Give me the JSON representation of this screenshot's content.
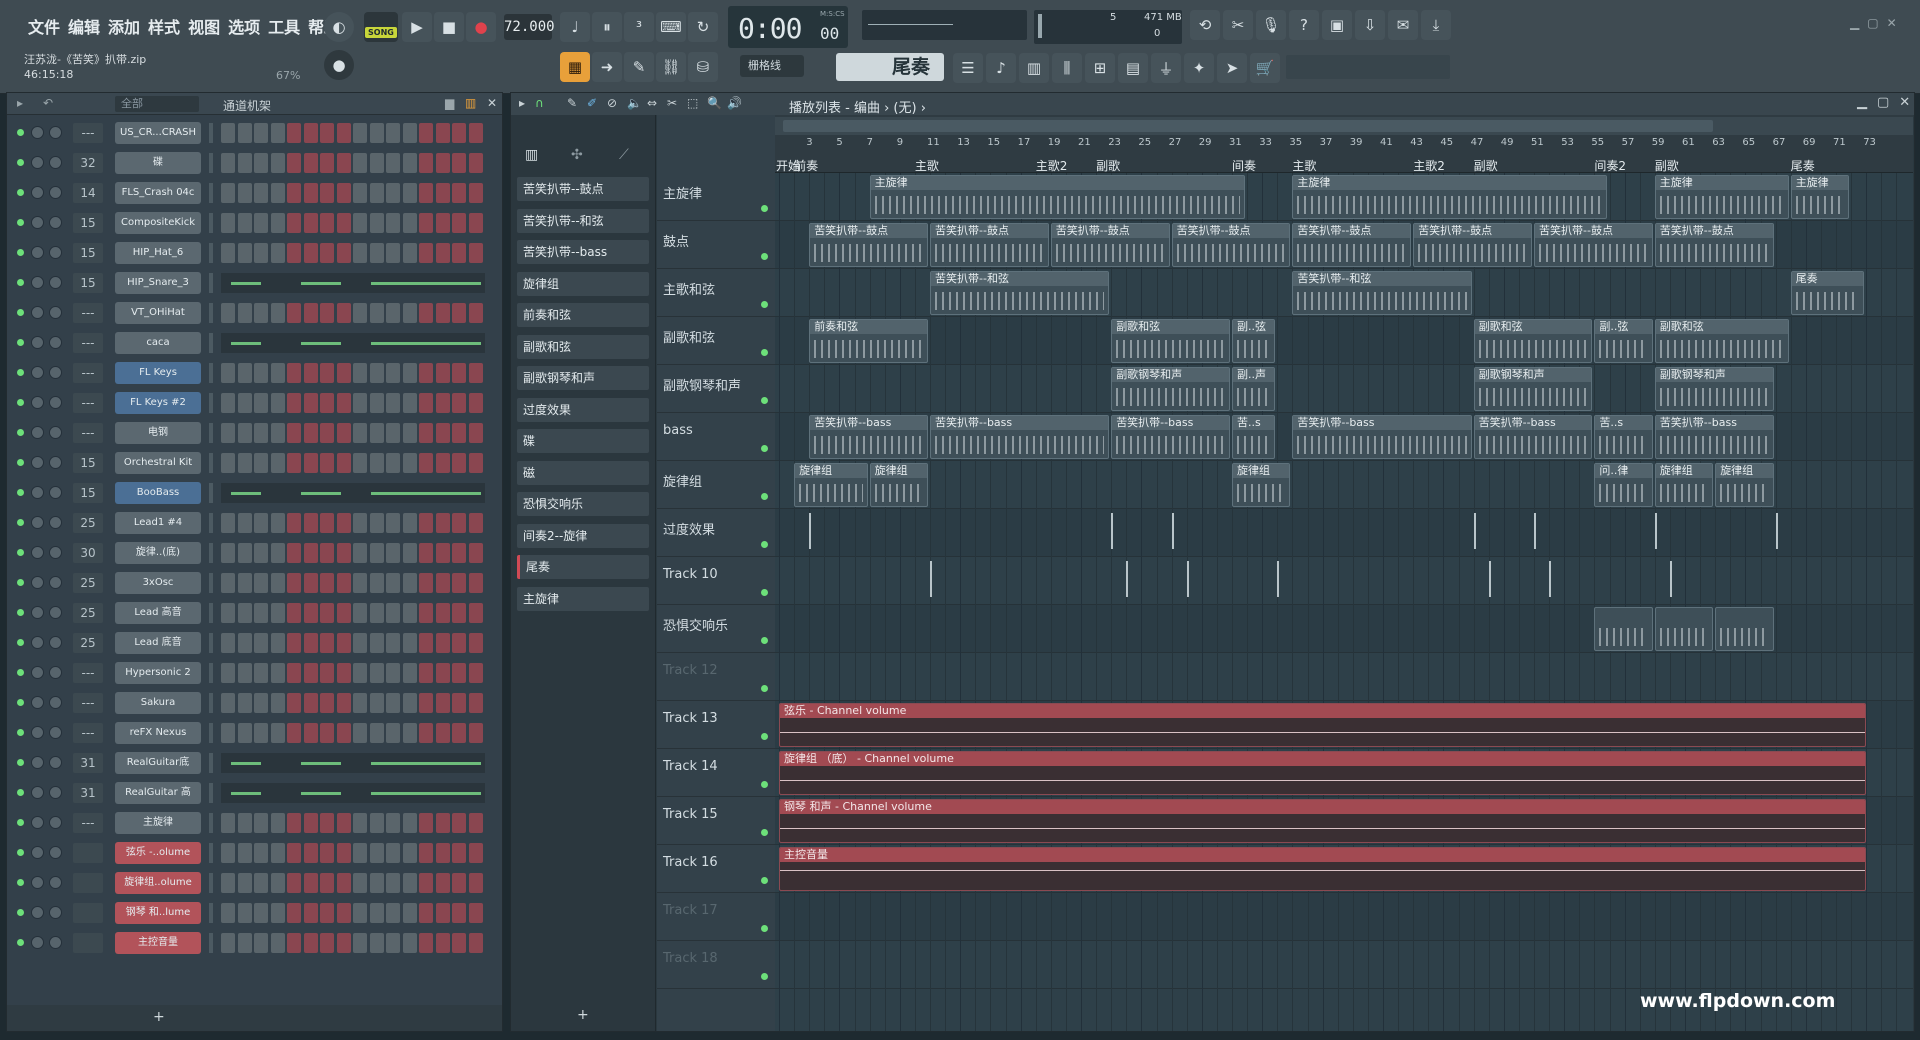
{
  "menu": [
    "文件",
    "编辑",
    "添加",
    "样式",
    "视图",
    "选项",
    "工具",
    "帮助"
  ],
  "song": {
    "file": "汪苏泷-《苦笑》扒带.zip",
    "time": "46:15:18",
    "volume": "67%"
  },
  "transport": {
    "mode_label": "SONG",
    "tempo": "72.000",
    "time": "0:00",
    "time_sub": "00",
    "time_label": "M:S:CS",
    "snap": "栅格线",
    "pattern": "尾奏"
  },
  "monitor": {
    "cpu": "5",
    "mem": "471 MB",
    "poly": "0"
  },
  "rack": {
    "filter": "全部",
    "title": "通道机架",
    "channels": [
      {
        "num": "---",
        "name": "US_CR...CRASH",
        "style": "gray",
        "type": "steps"
      },
      {
        "num": "32",
        "name": "碟",
        "style": "gray",
        "type": "steps"
      },
      {
        "num": "14",
        "name": "FLS_Crash 04c",
        "style": "gray",
        "type": "steps"
      },
      {
        "num": "15",
        "name": "CompositeKick",
        "style": "gray",
        "type": "steps"
      },
      {
        "num": "15",
        "name": "HIP_Hat_6",
        "style": "gray",
        "type": "steps"
      },
      {
        "num": "15",
        "name": "HIP_Snare_3",
        "style": "gray",
        "type": "pr"
      },
      {
        "num": "---",
        "name": "VT_OHiHat",
        "style": "gray",
        "type": "steps"
      },
      {
        "num": "---",
        "name": "caca",
        "style": "gray",
        "type": "pr"
      },
      {
        "num": "---",
        "name": "FL Keys",
        "style": "blue",
        "type": "steps"
      },
      {
        "num": "---",
        "name": "FL Keys #2",
        "style": "blue",
        "type": "steps"
      },
      {
        "num": "---",
        "name": "电钢",
        "style": "gray",
        "type": "steps"
      },
      {
        "num": "15",
        "name": "Orchestral Kit",
        "style": "gray",
        "type": "steps"
      },
      {
        "num": "15",
        "name": "BooBass",
        "style": "blue",
        "type": "pr"
      },
      {
        "num": "25",
        "name": "Lead1 #4",
        "style": "gray",
        "type": "steps"
      },
      {
        "num": "30",
        "name": "旋律..(底)",
        "style": "gray",
        "type": "steps"
      },
      {
        "num": "25",
        "name": "3xOsc",
        "style": "gray",
        "type": "steps"
      },
      {
        "num": "25",
        "name": "Lead 高音",
        "style": "gray",
        "type": "steps"
      },
      {
        "num": "25",
        "name": "Lead 底音",
        "style": "gray",
        "type": "steps"
      },
      {
        "num": "---",
        "name": "Hypersonic 2",
        "style": "gray",
        "type": "steps"
      },
      {
        "num": "---",
        "name": "Sakura",
        "style": "gray",
        "type": "steps"
      },
      {
        "num": "---",
        "name": "reFX Nexus",
        "style": "gray",
        "type": "steps"
      },
      {
        "num": "31",
        "name": "RealGuitar底",
        "style": "gray",
        "type": "pr"
      },
      {
        "num": "31",
        "name": "RealGuitar 高",
        "style": "gray",
        "type": "pr"
      },
      {
        "num": "---",
        "name": "主旋律",
        "style": "gray",
        "type": "steps"
      },
      {
        "num": "",
        "name": "弦乐 -..olume",
        "style": "red",
        "type": "steps"
      },
      {
        "num": "",
        "name": "旋律组..olume",
        "style": "red",
        "type": "steps"
      },
      {
        "num": "",
        "name": "钢琴 和..lume",
        "style": "red",
        "type": "steps"
      },
      {
        "num": "",
        "name": "主控音量",
        "style": "red",
        "type": "steps"
      }
    ]
  },
  "playlist": {
    "title": "播放列表 - 编曲 › (无) ›",
    "picker": [
      "苦笑扒带--鼓点",
      "苦笑扒带--和弦",
      "苦笑扒带--bass",
      "旋律组",
      "前奏和弦",
      "副歌和弦",
      "副歌钢琴和声",
      "过度效果",
      "碟",
      "磁",
      "恐惧交响乐",
      "间奏2--旋律",
      "尾奏",
      "主旋律"
    ],
    "tracks": [
      {
        "name": "主旋律",
        "dim": false
      },
      {
        "name": "鼓点",
        "dim": false
      },
      {
        "name": "主歌和弦",
        "dim": false
      },
      {
        "name": "副歌和弦",
        "dim": false
      },
      {
        "name": "副歌钢琴和声",
        "dim": false
      },
      {
        "name": "bass",
        "dim": false
      },
      {
        "name": "旋律组",
        "dim": false
      },
      {
        "name": "过度效果",
        "dim": false
      },
      {
        "name": "Track 10",
        "dim": false
      },
      {
        "name": "恐惧交响乐",
        "dim": false
      },
      {
        "name": "Track 12",
        "dim": true
      },
      {
        "name": "Track 13",
        "dim": false
      },
      {
        "name": "Track 14",
        "dim": false
      },
      {
        "name": "Track 15",
        "dim": false
      },
      {
        "name": "Track 16",
        "dim": false
      },
      {
        "name": "Track 17",
        "dim": true
      },
      {
        "name": "Track 18",
        "dim": true
      }
    ],
    "bars": [
      "3",
      "5",
      "7",
      "9",
      "11",
      "13",
      "15",
      "17",
      "19",
      "21",
      "23",
      "25",
      "27",
      "29",
      "31",
      "33",
      "35",
      "37",
      "39",
      "41",
      "43",
      "45",
      "47",
      "49",
      "51",
      "53",
      "55",
      "57",
      "59",
      "61",
      "63",
      "65",
      "67",
      "69",
      "71",
      "73"
    ],
    "markers": [
      {
        "label": "开始",
        "bar": 1
      },
      {
        "label": "前奏",
        "bar": 2
      },
      {
        "label": "主歌",
        "bar": 10
      },
      {
        "label": "主歌2",
        "bar": 18
      },
      {
        "label": "副歌",
        "bar": 22
      },
      {
        "label": "间奏",
        "bar": 31
      },
      {
        "label": "主歌",
        "bar": 35
      },
      {
        "label": "主歌2",
        "bar": 43
      },
      {
        "label": "副歌",
        "bar": 47
      },
      {
        "label": "间奏2",
        "bar": 55
      },
      {
        "label": "副歌",
        "bar": 59
      },
      {
        "label": "尾奏",
        "bar": 68
      }
    ],
    "clips": [
      {
        "track": 0,
        "start": 7,
        "len": 25,
        "label": "主旋律"
      },
      {
        "track": 0,
        "start": 35,
        "len": 21,
        "label": "主旋律"
      },
      {
        "track": 0,
        "start": 59,
        "len": 9,
        "label": "主旋律"
      },
      {
        "track": 0,
        "start": 68,
        "len": 4,
        "label": "主旋律"
      },
      {
        "track": 1,
        "start": 3,
        "len": 8,
        "label": "苦笑扒带--鼓点"
      },
      {
        "track": 1,
        "start": 11,
        "len": 8,
        "label": "苦笑扒带--鼓点"
      },
      {
        "track": 1,
        "start": 19,
        "len": 8,
        "label": "苦笑扒带--鼓点"
      },
      {
        "track": 1,
        "start": 27,
        "len": 8,
        "label": "苦笑扒带--鼓点"
      },
      {
        "track": 1,
        "start": 35,
        "len": 8,
        "label": "苦笑扒带--鼓点"
      },
      {
        "track": 1,
        "start": 43,
        "len": 8,
        "label": "苦笑扒带--鼓点"
      },
      {
        "track": 1,
        "start": 51,
        "len": 8,
        "label": "苦笑扒带--鼓点"
      },
      {
        "track": 1,
        "start": 59,
        "len": 8,
        "label": "苦笑扒带--鼓点"
      },
      {
        "track": 2,
        "start": 11,
        "len": 12,
        "label": "苦笑扒带--和弦"
      },
      {
        "track": 2,
        "start": 35,
        "len": 12,
        "label": "苦笑扒带--和弦"
      },
      {
        "track": 2,
        "start": 68,
        "len": 5,
        "label": "尾奏"
      },
      {
        "track": 3,
        "start": 3,
        "len": 8,
        "label": "前奏和弦"
      },
      {
        "track": 3,
        "start": 23,
        "len": 8,
        "label": "副歌和弦"
      },
      {
        "track": 3,
        "start": 31,
        "len": 3,
        "label": "副..弦"
      },
      {
        "track": 3,
        "start": 47,
        "len": 8,
        "label": "副歌和弦"
      },
      {
        "track": 3,
        "start": 55,
        "len": 4,
        "label": "副..弦"
      },
      {
        "track": 3,
        "start": 59,
        "len": 9,
        "label": "副歌和弦"
      },
      {
        "track": 4,
        "start": 23,
        "len": 8,
        "label": "副歌钢琴和声"
      },
      {
        "track": 4,
        "start": 31,
        "len": 3,
        "label": "副..声"
      },
      {
        "track": 4,
        "start": 47,
        "len": 8,
        "label": "副歌钢琴和声"
      },
      {
        "track": 4,
        "start": 59,
        "len": 8,
        "label": "副歌钢琴和声"
      },
      {
        "track": 5,
        "start": 3,
        "len": 8,
        "label": "苦笑扒带--bass"
      },
      {
        "track": 5,
        "start": 11,
        "len": 12,
        "label": "苦笑扒带--bass"
      },
      {
        "track": 5,
        "start": 23,
        "len": 8,
        "label": "苦笑扒带--bass"
      },
      {
        "track": 5,
        "start": 31,
        "len": 3,
        "label": "苦..s"
      },
      {
        "track": 5,
        "start": 35,
        "len": 12,
        "label": "苦笑扒带--bass"
      },
      {
        "track": 5,
        "start": 47,
        "len": 8,
        "label": "苦笑扒带--bass"
      },
      {
        "track": 5,
        "start": 55,
        "len": 4,
        "label": "苦..s"
      },
      {
        "track": 5,
        "start": 59,
        "len": 8,
        "label": "苦笑扒带--bass"
      },
      {
        "track": 6,
        "start": 2,
        "len": 5,
        "label": "旋律组"
      },
      {
        "track": 6,
        "start": 7,
        "len": 4,
        "label": "旋律组"
      },
      {
        "track": 6,
        "start": 31,
        "len": 4,
        "label": "旋律组"
      },
      {
        "track": 6,
        "start": 55,
        "len": 4,
        "label": "问..律"
      },
      {
        "track": 6,
        "start": 59,
        "len": 4,
        "label": "旋律组"
      },
      {
        "track": 6,
        "start": 63,
        "len": 4,
        "label": "旋律组"
      }
    ],
    "autoclips": [
      {
        "track": 11,
        "label": "弦乐 - Channel volume"
      },
      {
        "track": 12,
        "label": "旋律组 （底） - Channel volume"
      },
      {
        "track": 13,
        "label": "钢琴 和声 - Channel volume"
      },
      {
        "track": 14,
        "label": "主控音量"
      }
    ]
  },
  "watermark": "www.flpdown.com"
}
